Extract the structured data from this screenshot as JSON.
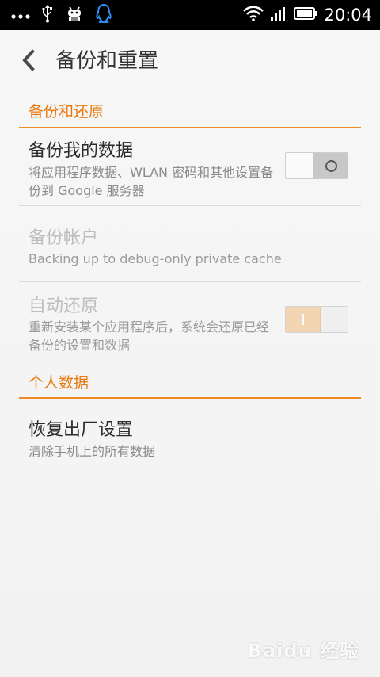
{
  "status_bar": {
    "time": "20:04",
    "icons_left": [
      "more-dots-icon",
      "usb-icon",
      "android-debug-icon",
      "qq-icon"
    ],
    "icons_right": [
      "wifi-icon",
      "signal-icon",
      "battery-icon"
    ]
  },
  "header": {
    "title": "备份和重置"
  },
  "sections": [
    {
      "label": "备份和还原"
    },
    {
      "label": "个人数据"
    }
  ],
  "rows": {
    "backup_data": {
      "title": "备份我的数据",
      "subtitle": "将应用程序数据、WLAN 密码和其他设置备份到 Google 服务器",
      "toggle_state": "off"
    },
    "backup_account": {
      "title": "备份帐户",
      "subtitle": "Backing up to debug-only private cache"
    },
    "auto_restore": {
      "title": "自动还原",
      "subtitle": "重新安装某个应用程序后，系统会还原已经备份的设置和数据",
      "toggle_state": "on"
    },
    "factory_reset": {
      "title": "恢复出厂设置",
      "subtitle": "清除手机上的所有数据"
    }
  },
  "watermark": "Baidu 经验",
  "colors": {
    "accent": "#e8790e",
    "divider_accent": "#f08a24"
  }
}
